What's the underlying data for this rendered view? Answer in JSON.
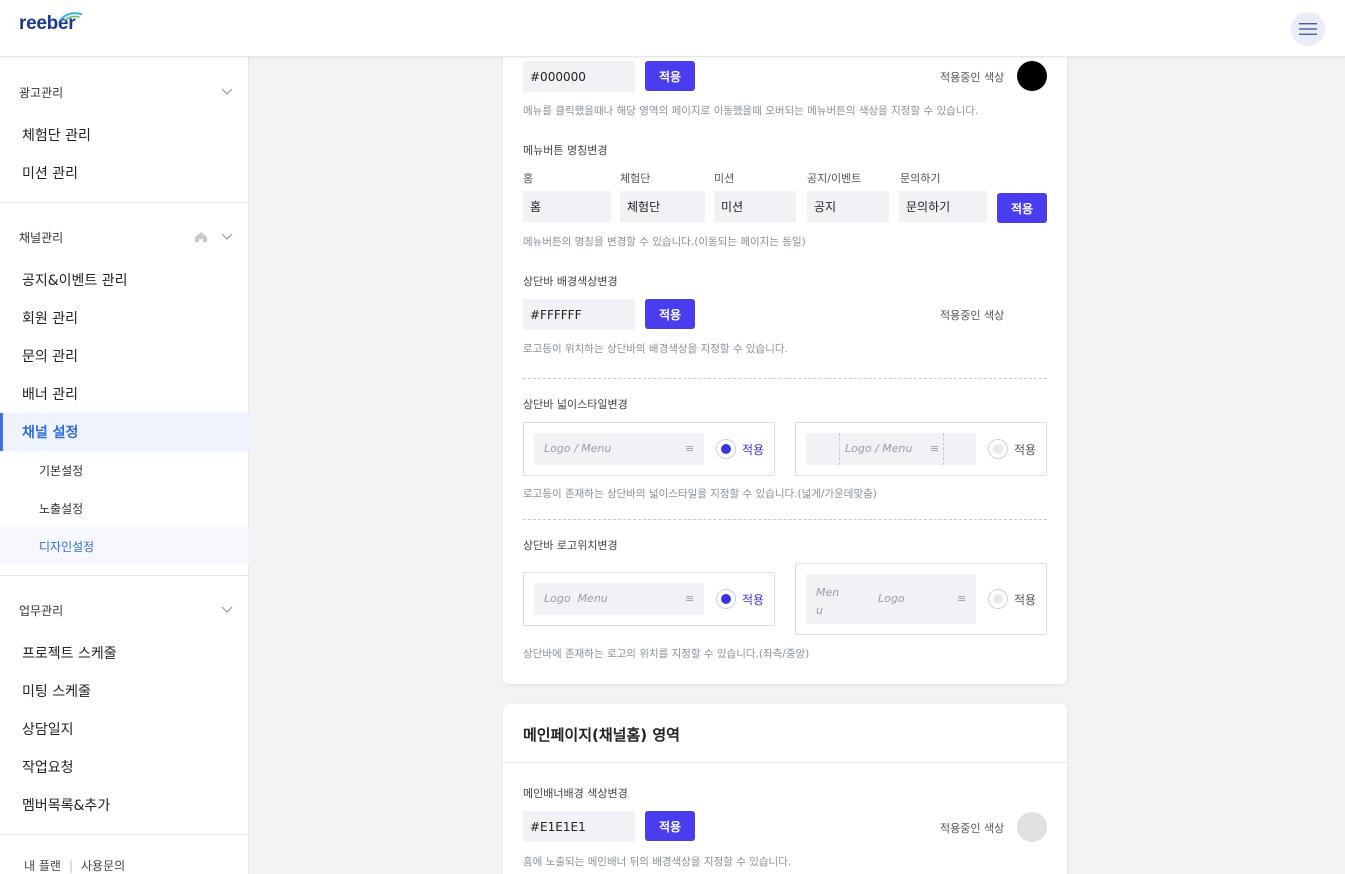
{
  "header": {
    "logo_text": "reeber",
    "menu_icon": "hamburger-icon"
  },
  "sidebar": {
    "ad_section": {
      "title": "광고관리",
      "items": [
        {
          "label": "체험단 관리"
        },
        {
          "label": "미션 관리"
        }
      ]
    },
    "channel_section": {
      "title": "채널관리",
      "items": [
        {
          "label": "공지&이벤트 관리"
        },
        {
          "label": "회원 관리"
        },
        {
          "label": "문의 관리"
        },
        {
          "label": "배너 관리"
        },
        {
          "label": "채널 설정"
        }
      ],
      "subitems": [
        {
          "label": "기본설정"
        },
        {
          "label": "노출설정"
        },
        {
          "label": "디자인설정"
        }
      ]
    },
    "work_section": {
      "title": "업무관리",
      "items": [
        {
          "label": "프로젝트 스케줄"
        },
        {
          "label": "미팅 스케줄"
        },
        {
          "label": "상담일지"
        },
        {
          "label": "작업요청"
        },
        {
          "label": "멤버목록&추가"
        }
      ]
    },
    "footer": {
      "plan": "내 플랜",
      "contact": "사용문의"
    }
  },
  "design_card": {
    "hover_color": {
      "value": "#000000",
      "apply": "적용",
      "current_label": "적용중인 색상",
      "swatch_color": "#000000",
      "desc": "메뉴를 클릭했을때나 해당 영역의 페이지로 이동했을때 오버되는 메뉴버튼의 색상을 지정할 수 있습니다."
    },
    "menu_names": {
      "label": "메뉴버튼 명칭변경",
      "fields": [
        {
          "caption": "홈",
          "value": "홈"
        },
        {
          "caption": "체험단",
          "value": "체험단"
        },
        {
          "caption": "미션",
          "value": "미션"
        },
        {
          "caption": "공지/이벤트",
          "value": "공지"
        },
        {
          "caption": "문의하기",
          "value": "문의하기"
        }
      ],
      "apply": "적용",
      "desc": "메뉴버튼의 명칭을 변경할 수 있습니다.(이동되는 페이지는 동일)"
    },
    "topbar_bg": {
      "label": "상단바 배경색상변경",
      "value": "#FFFFFF",
      "apply": "적용",
      "current_label": "적용중인 색상",
      "swatch_color": "#FFFFFF",
      "desc": "로고등이 위치하는 상단바의 배경색상을 지정할 수 있습니다."
    },
    "topbar_width": {
      "label": "상단바 넓이스타일변경",
      "options": [
        {
          "preview_text": "Logo / Menu",
          "apply": "적용",
          "selected": true
        },
        {
          "preview_text": "Logo / Menu",
          "apply": "적용",
          "selected": false
        }
      ],
      "desc": "로고등이 존재하는 상단바의 넓이스타일을 지정할 수 있습니다.(넓게/가운데맞춤)"
    },
    "logo_position": {
      "label": "상단바 로고위치변경",
      "options": [
        {
          "preview_text": "Logo  Menu",
          "apply": "적용",
          "selected": true
        },
        {
          "preview_menu": "Men u",
          "preview_logo": "Logo",
          "apply": "적용",
          "selected": false
        }
      ],
      "desc": "상단바에 존재하는 로고의 위치를 지정할 수 있습니다.(좌측/중앙)"
    }
  },
  "main_card": {
    "title": "메인페이지(채널홈) 영역",
    "banner_bg": {
      "label": "메인배너배경 색상변경",
      "value": "#E1E1E1",
      "apply": "적용",
      "current_label": "적용중인 색상",
      "swatch_color": "#E1E1E1",
      "desc": "홈에 노출되는 메인배너 뒤의 배경색상을 지정할 수 있습니다."
    }
  },
  "colors": {
    "accent": "#4A3DF0",
    "active_nav": "#2D6CDF",
    "brand": "#1A3A8C"
  }
}
